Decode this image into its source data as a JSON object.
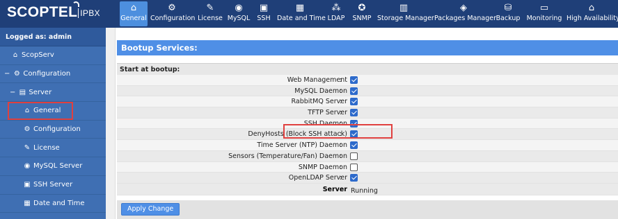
{
  "logo": {
    "brand": "SCOPTEL",
    "suffix": "IPBX"
  },
  "sidebar": {
    "logged_as": "Logged as: admin",
    "items": [
      {
        "label": "ScopServ",
        "icon": "home-icon"
      },
      {
        "label": "Configuration",
        "icon": "gear-icon",
        "toggle": "−"
      },
      {
        "label": "Server",
        "icon": "server-icon",
        "toggle": "−"
      },
      {
        "label": "General",
        "icon": "home-icon"
      },
      {
        "label": "Configuration",
        "icon": "gear-icon"
      },
      {
        "label": "License",
        "icon": "wrench-icon"
      },
      {
        "label": "MySQL Server",
        "icon": "database-icon"
      },
      {
        "label": "SSH Server",
        "icon": "terminal-icon"
      },
      {
        "label": "Date and Time",
        "icon": "calendar-icon"
      }
    ]
  },
  "toolbar": {
    "items": [
      {
        "label": "General",
        "icon": "home-icon",
        "active": true
      },
      {
        "label": "Configuration",
        "icon": "gear-icon"
      },
      {
        "label": "License",
        "icon": "wrench-icon"
      },
      {
        "label": "MySQL",
        "icon": "database-icon"
      },
      {
        "label": "SSH",
        "icon": "terminal-icon"
      },
      {
        "label": "Date and Time",
        "icon": "calendar-icon"
      },
      {
        "label": "LDAP",
        "icon": "network-icon"
      },
      {
        "label": "SNMP",
        "icon": "lifebuoy-icon"
      },
      {
        "label": "Storage Manager",
        "icon": "storage-icon"
      },
      {
        "label": "Packages Manager",
        "icon": "package-icon"
      },
      {
        "label": "Backup",
        "icon": "backup-icon"
      },
      {
        "label": "Monitoring",
        "icon": "monitor-icon"
      },
      {
        "label": "High Availability",
        "icon": "building-icon"
      }
    ]
  },
  "main": {
    "title": "Bootup Services:",
    "subtitle": "Start at bootup:",
    "services": [
      {
        "label": "Web Management",
        "checked": true
      },
      {
        "label": "MySQL Daemon",
        "checked": true
      },
      {
        "label": "RabbitMQ Server",
        "checked": true
      },
      {
        "label": "TFTP Server",
        "checked": true
      },
      {
        "label": "SSH Daemon",
        "checked": true
      },
      {
        "label": "DenyHosts (Block SSH attack)",
        "checked": true
      },
      {
        "label": "Time Server (NTP) Daemon",
        "checked": true
      },
      {
        "label": "Sensors (Temperature/Fan) Daemon",
        "checked": false
      },
      {
        "label": "SNMP Daemon",
        "checked": false
      },
      {
        "label": "OpenLDAP Server",
        "checked": true
      }
    ],
    "server": {
      "label": "Server",
      "value": "Running"
    },
    "colon": ":",
    "apply_label": "Apply Change"
  },
  "colors": {
    "accent": "#4f8fe6",
    "sidebar": "#3f6fb3",
    "toolbar": "#1f3f78",
    "highlight": "#e0403f"
  }
}
